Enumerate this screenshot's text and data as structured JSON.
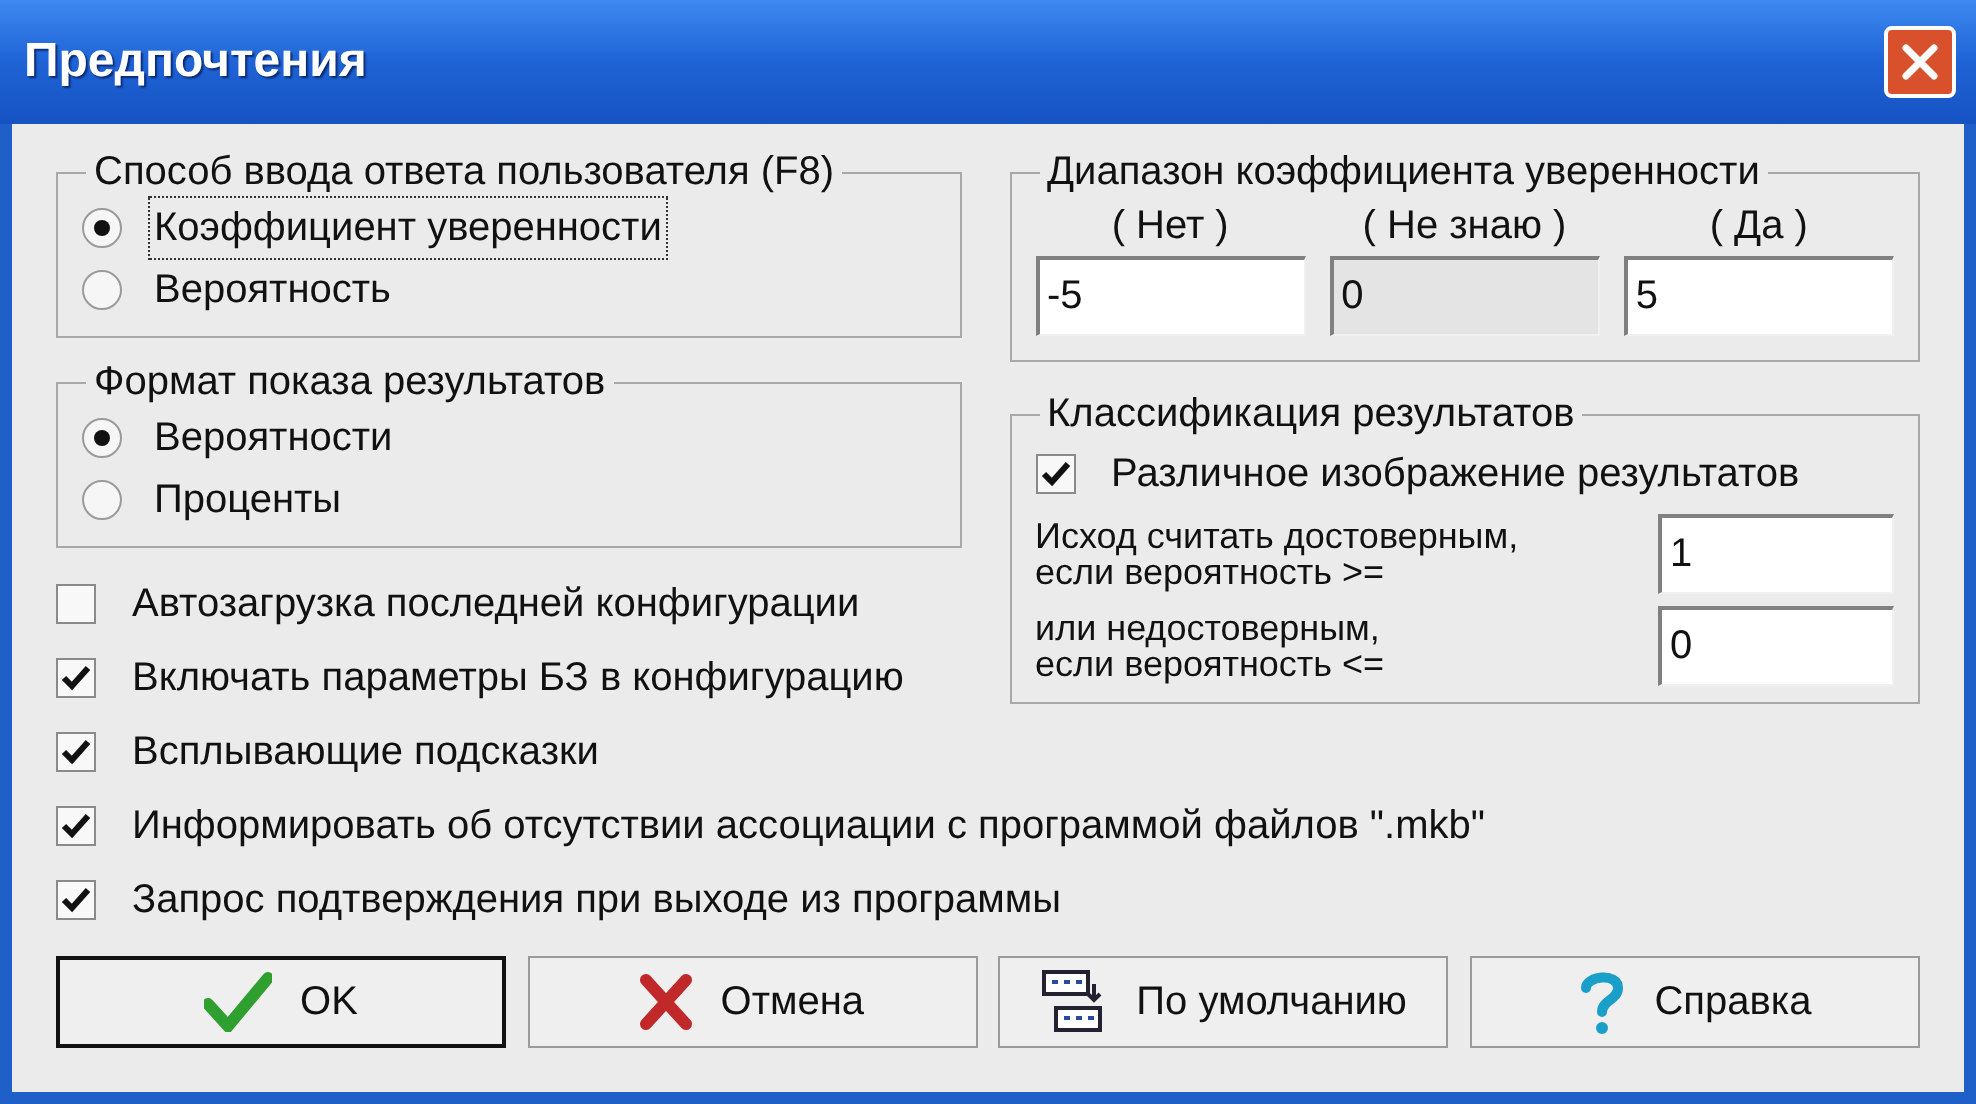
{
  "window": {
    "title": "Предпочтения"
  },
  "input_method": {
    "title": "Способ ввода ответа пользователя (F8)",
    "options": [
      {
        "label": "Коэффициент уверенности",
        "selected": true,
        "focused": true
      },
      {
        "label": "Вероятность",
        "selected": false,
        "focused": false
      }
    ]
  },
  "result_format": {
    "title": "Формат показа результатов",
    "options": [
      {
        "label": "Вероятности",
        "selected": true,
        "focused": false
      },
      {
        "label": "Проценты",
        "selected": false,
        "focused": false
      }
    ]
  },
  "options": [
    {
      "label": "Автозагрузка последней конфигурации",
      "checked": false
    },
    {
      "label": "Включать параметры БЗ в конфигурацию",
      "checked": true
    },
    {
      "label": "Всплывающие подсказки",
      "checked": true
    },
    {
      "label": "Информировать об отсутствии ассоциации с программой файлов \".mkb\"",
      "checked": true
    },
    {
      "label": "Запрос подтверждения при выходе из программы",
      "checked": true
    }
  ],
  "confidence_range": {
    "title": "Диапазон коэффициента уверенности",
    "fields": [
      {
        "label": "( Нет )",
        "value": "-5",
        "disabled": false
      },
      {
        "label": "( Не знаю )",
        "value": "0",
        "disabled": true
      },
      {
        "label": "( Да )",
        "value": "5",
        "disabled": false
      }
    ]
  },
  "classification": {
    "title": "Классификация результатов",
    "checkbox": {
      "label": "Различное изображение результатов",
      "checked": true
    },
    "thresholds": [
      {
        "label": "Исход считать достоверным,\nесли вероятность  >=",
        "value": "1"
      },
      {
        "label": "или недостоверным,\nесли вероятность  <=",
        "value": "0"
      }
    ]
  },
  "buttons": [
    {
      "label": "OK",
      "kind": "ok",
      "default": true
    },
    {
      "label": "Отмена",
      "kind": "cancel",
      "default": false
    },
    {
      "label": "По умолчанию",
      "kind": "defaults",
      "default": false
    },
    {
      "label": "Справка",
      "kind": "help",
      "default": false
    }
  ]
}
